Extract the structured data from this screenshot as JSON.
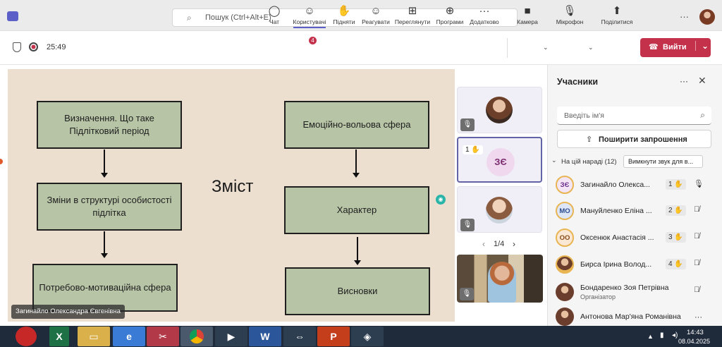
{
  "header": {
    "search_placeholder": "Пошук (Ctrl+Alt+E)",
    "more": "···"
  },
  "meeting": {
    "timer": "25:49",
    "toolbar": [
      {
        "label": "Чат",
        "glyph": "◯"
      },
      {
        "label": "Користувачі",
        "glyph": "☺",
        "badge": "4"
      },
      {
        "label": "Підняти",
        "glyph": "✋"
      },
      {
        "label": "Реагувати",
        "glyph": "☺"
      },
      {
        "label": "Переглянути",
        "glyph": "⊞"
      },
      {
        "label": "Програми",
        "glyph": "⊕"
      },
      {
        "label": "Додатково",
        "glyph": "···"
      },
      {
        "label": "Камера",
        "glyph": "■"
      },
      {
        "label": "Мікрофон",
        "glyph": "🎙"
      },
      {
        "label": "Поділитися",
        "glyph": "⬆"
      }
    ],
    "leave_label": "Вийти"
  },
  "slide": {
    "title": "Зміст",
    "boxes_left": [
      "Визначення. Що таке Підлітковий період",
      "Зміни в структурі особистості підлітка",
      "Потребово-мотиваційна сфера"
    ],
    "boxes_right": [
      "Емоційно-вольова сфера",
      "Характер",
      "Висновки"
    ]
  },
  "presenter_label": "Загинайло Олександра Євгенівна",
  "tiles": {
    "initials": "ЗЄ",
    "hand_count": "1",
    "pager": "1/4"
  },
  "panel": {
    "title": "Учасники",
    "search_placeholder": "Введіть ім'я",
    "share_invite": "Поширити запрошення",
    "section": "На цій нараді (12)",
    "mute_all": "Вимкнути звук для в...",
    "participants": [
      {
        "initials": "ЗЄ",
        "name": "Загинайло Олекса...",
        "hand": "1",
        "mic": "on"
      },
      {
        "initials": "МО",
        "name": "Мануйленко Еліна ...",
        "hand": "2",
        "mic": "off"
      },
      {
        "initials": "ОО",
        "name": "Оксенюк Анастасія ...",
        "hand": "3",
        "mic": "off"
      },
      {
        "initials": "",
        "name": "Бирса Ірина Волод...",
        "hand": "4",
        "mic": "off"
      },
      {
        "initials": "",
        "name": "Бондаренко Зоя Петрівна",
        "role": "Організатор",
        "mic": "off"
      },
      {
        "initials": "",
        "name": "Антонова Мар'яна Романівна",
        "more": "···"
      }
    ]
  },
  "taskbar": {
    "time": "14:43",
    "date": "08.04.2025"
  }
}
